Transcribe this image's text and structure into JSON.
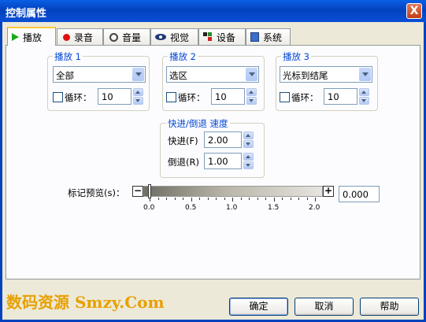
{
  "window": {
    "title": "控制属性",
    "close_label": "X"
  },
  "tabs": [
    {
      "label": "播放",
      "icon": "play-icon"
    },
    {
      "label": "录音",
      "icon": "record-icon"
    },
    {
      "label": "音量",
      "icon": "volume-icon"
    },
    {
      "label": "视觉",
      "icon": "eye-icon"
    },
    {
      "label": "设备",
      "icon": "device-icon"
    },
    {
      "label": "系统",
      "icon": "system-icon"
    }
  ],
  "play_groups": [
    {
      "title": "播放 1",
      "mode": "全部",
      "loop_label": "循环：",
      "loop_checked": false,
      "loop_count": "10"
    },
    {
      "title": "播放 2",
      "mode": "选区",
      "loop_label": "循环：",
      "loop_checked": false,
      "loop_count": "10"
    },
    {
      "title": "播放 3",
      "mode": "光标到结尾",
      "loop_label": "循环：",
      "loop_checked": false,
      "loop_count": "10"
    }
  ],
  "speed": {
    "title": "快进/倒退 速度",
    "forward_label": "快进(F)",
    "forward_value": "2.00",
    "rewind_label": "倒退(R)",
    "rewind_value": "1.00"
  },
  "marker_preview": {
    "label": "标记预览(s)：",
    "minus": "−",
    "plus": "+",
    "value": "0.000",
    "slider_value": 0.0,
    "ticks": [
      "0.0",
      "0.5",
      "1.0",
      "1.5",
      "2.0"
    ]
  },
  "watermark": "数码资源 Smzy.Com",
  "buttons": {
    "ok": "确定",
    "cancel": "取消",
    "help": "帮助"
  },
  "colors": {
    "titlebar": "#0A5FE6",
    "group_title": "#0046D5",
    "close": "#C43D14",
    "watermark": "#E8A000"
  }
}
